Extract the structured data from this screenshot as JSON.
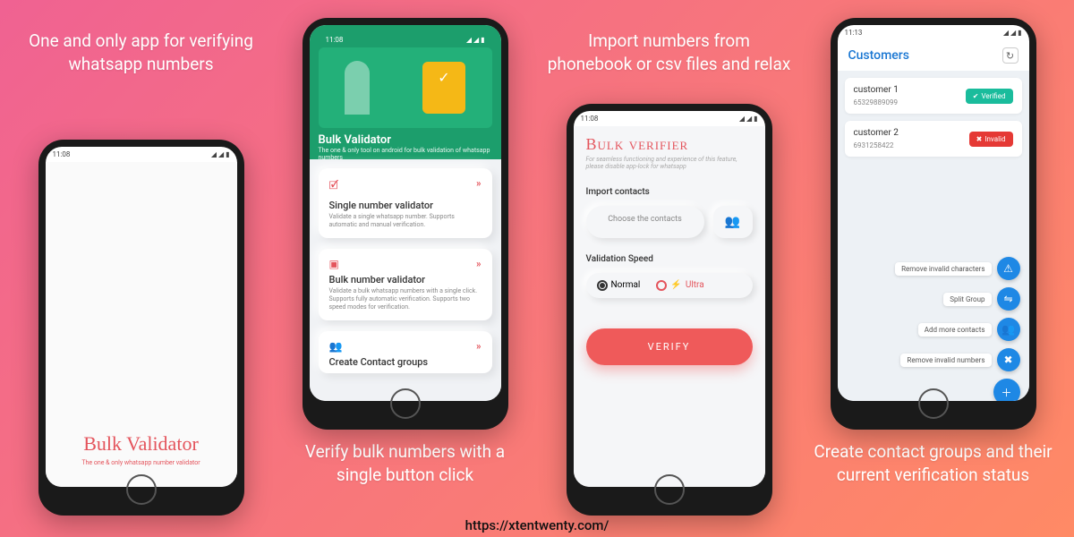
{
  "footer_url": "https://xtentwenty.com/",
  "captions": {
    "c1": "One and only app for verifying whatsapp numbers",
    "c2": "Verify bulk numbers with a single button click",
    "c3": "Import numbers from phonebook or csv files and relax",
    "c4": "Create contact groups and their current verification status"
  },
  "status_time": "11:08",
  "phone1": {
    "title": "Bulk Validator",
    "subtitle": "The one & only whatsapp number validator"
  },
  "phone2": {
    "hero_title": "Bulk Validator",
    "hero_sub": "The one & only tool on android for bulk validation of whatsapp numbers",
    "cards": [
      {
        "title": "Single number validator",
        "desc": "Validate a single whatsapp number. Supports automatic and manual verification."
      },
      {
        "title": "Bulk number validator",
        "desc": "Validate a bulk whatsapp numbers with a single click. Supports fully automatic verification. Supports two speed modes for verification."
      },
      {
        "title": "Create Contact groups",
        "desc": ""
      }
    ]
  },
  "phone3": {
    "title": "Bulk verifier",
    "hint": "For seamless functioning and experience of this feature, please disable app-lock for whatsapp",
    "section_import": "Import contacts",
    "choose_label": "Choose the contacts",
    "section_speed": "Validation Speed",
    "speed_normal": "Normal",
    "speed_ultra": "Ultra",
    "verify_label": "VERIFY"
  },
  "phone4": {
    "title": "Customers",
    "rows": [
      {
        "name": "customer 1",
        "number": "65329889099",
        "status": "Verified",
        "status_type": "verified"
      },
      {
        "name": "customer 2",
        "number": "6931258422",
        "status": "Invalid",
        "status_type": "invalid"
      }
    ],
    "fabs": [
      {
        "label": "Remove invalid characters",
        "icon": "⚠"
      },
      {
        "label": "Split Group",
        "icon": "⇋"
      },
      {
        "label": "Add more contacts",
        "icon": "👥"
      },
      {
        "label": "Remove invalid numbers",
        "icon": "✖"
      }
    ],
    "fab_main_icon": "＋"
  }
}
